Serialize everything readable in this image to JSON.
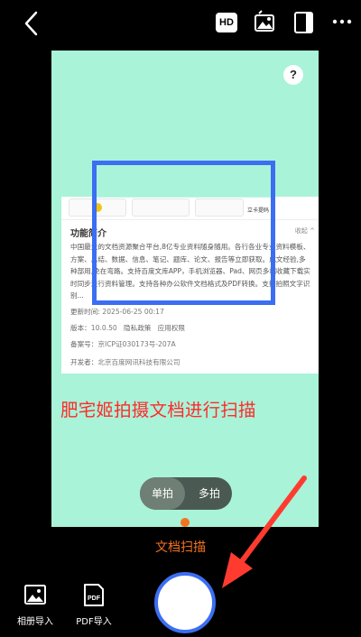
{
  "topbar": {
    "hd_label": "HD"
  },
  "preview": {
    "help_label": "?",
    "doc": {
      "thumb_note": "立卡提码",
      "heading": "功能简介",
      "collapse": "收起 ^",
      "description": "中国最大的文档资源聚合平台,8亿专业资料随身随用。各行各业专业资料模板、方案、总结、数据、信息、笔记、题库、论文、报告等立即获取。成文经验,多种部用,免在弯路。支持百度文库APP，手机浏览器、Pad、网页多端收藏下载实时同步进行资料管理。支持各种办公软件文档格式及PDF转换。支持拍照文字识别...",
      "update_label": "更新时间:",
      "update_value": "2025-06-25 00:17",
      "version_label": "版本：",
      "version_value": "10.0.50",
      "privacy": "隐私政策",
      "permissions": "应用权限",
      "icp_label": "备案号：",
      "icp_value": "京ICP证030173号-207A",
      "developer_label": "开发者：",
      "developer_value": "北京百度网讯科技有限公司"
    },
    "caption": "肥宅姬拍摄文档进行扫描",
    "toggle": {
      "single": "单拍",
      "multi": "多拍"
    }
  },
  "bottom": {
    "mode_label": "文档扫描",
    "album_label": "相册导入",
    "pdf_label": "PDF导入",
    "pdf_icon_text": "PDF"
  },
  "colors": {
    "preview_bg": "#a9f3d9",
    "scan_frame": "#3b6ef2",
    "accent": "#f4731f",
    "caption": "#ff2a2a",
    "arrow": "#ff3b30"
  }
}
